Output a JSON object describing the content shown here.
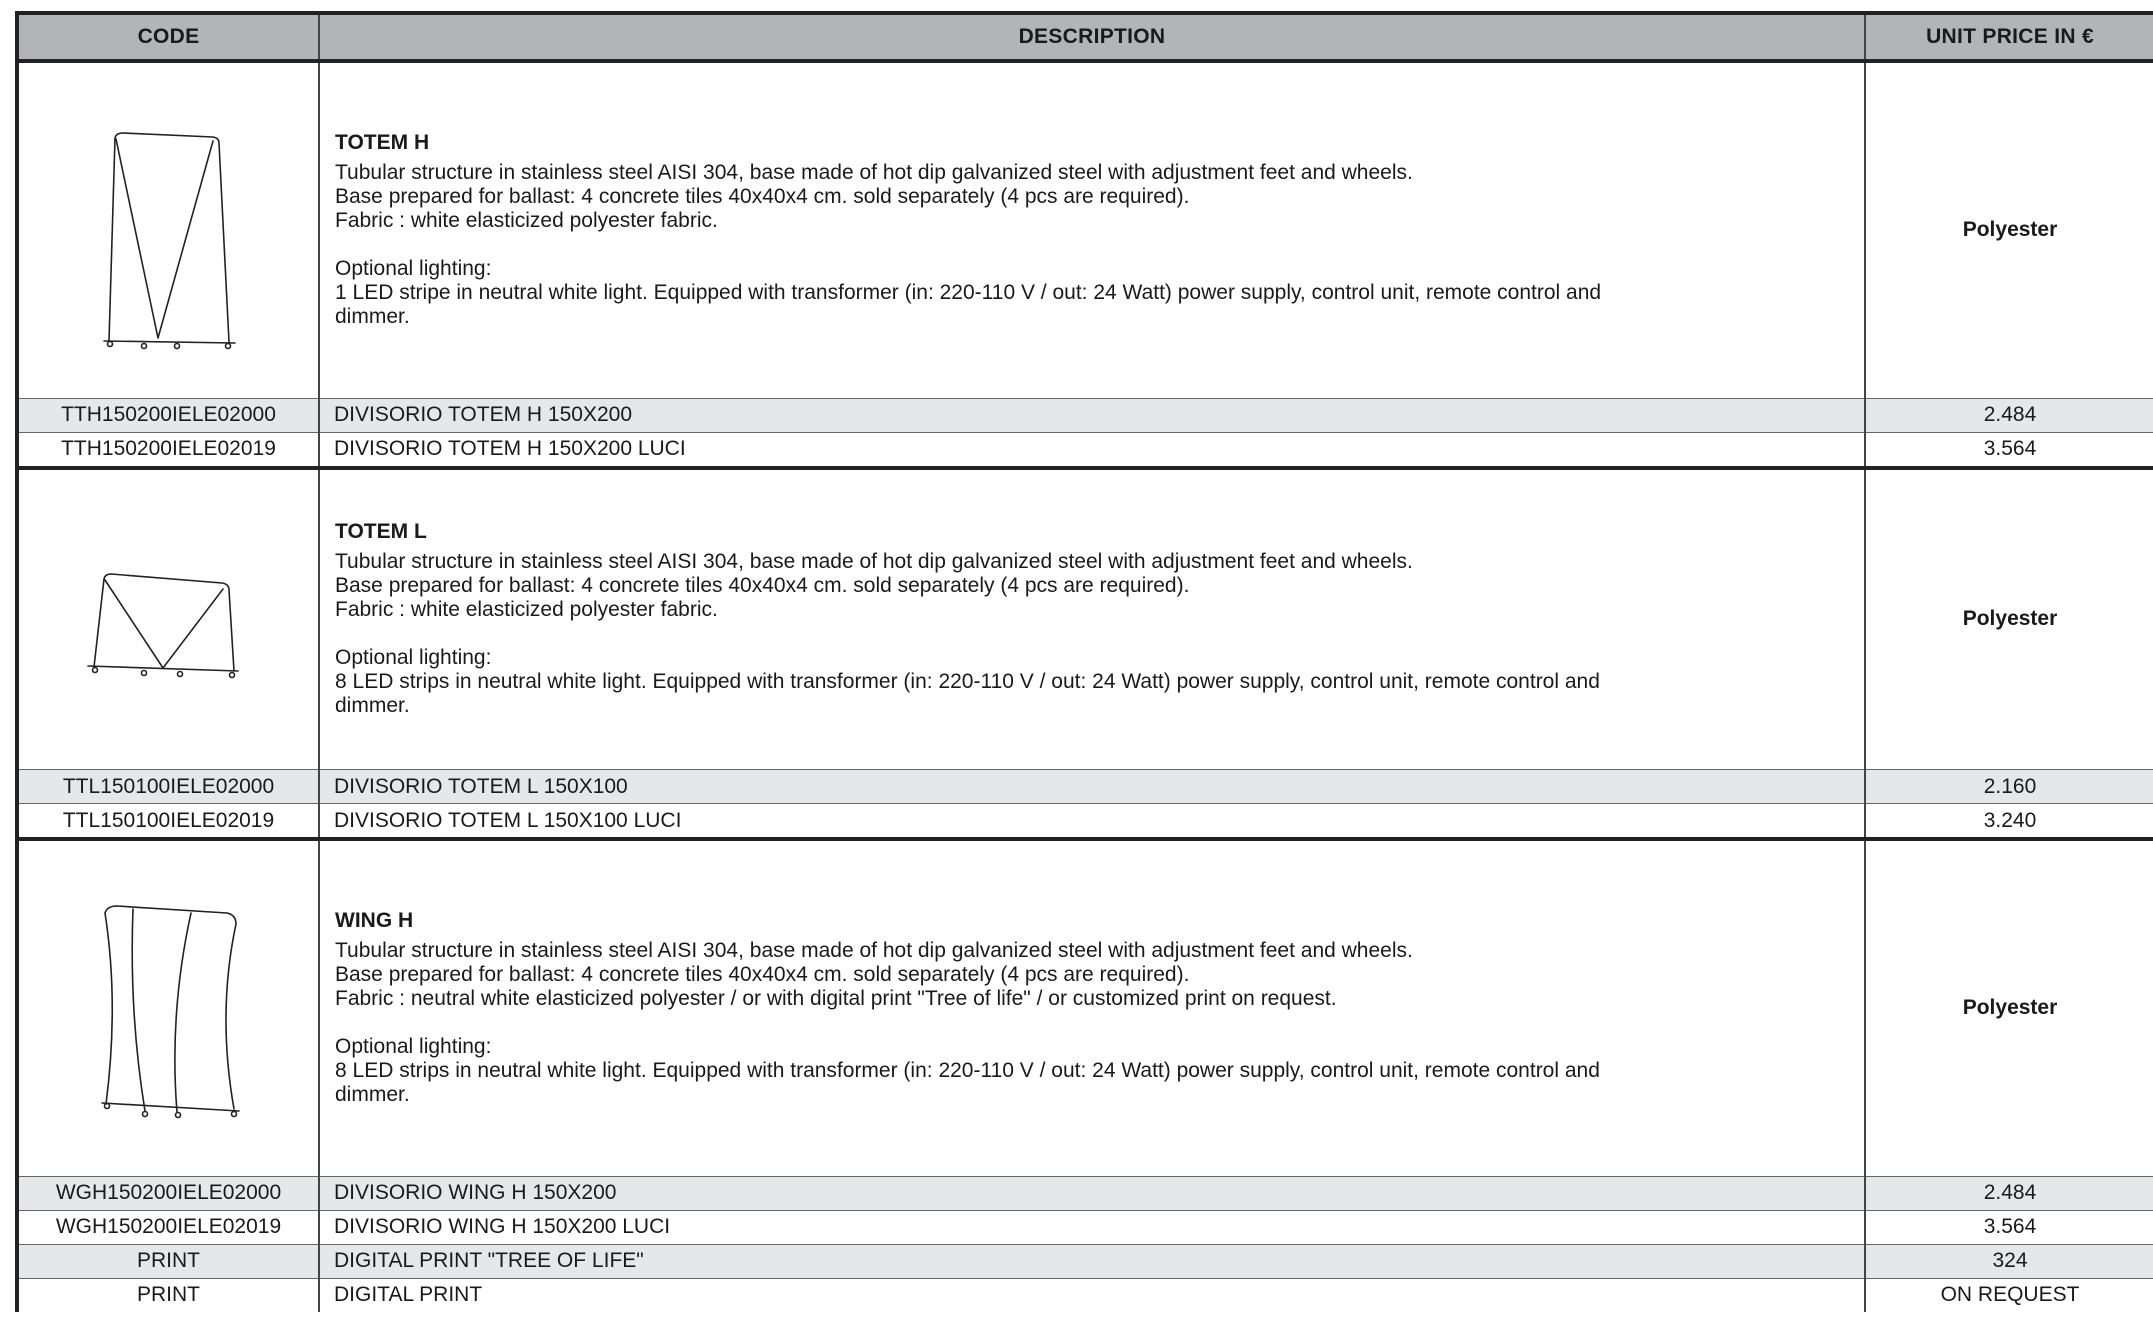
{
  "table": {
    "headers": {
      "code": "CODE",
      "description": "DESCRIPTION",
      "price": "UNIT PRICE IN €"
    }
  },
  "products": [
    {
      "title": "TOTEM H",
      "text_lines": [
        "Tubular structure in stainless steel AISI 304, base made of hot dip galvanized steel with adjustment feet and wheels.",
        "Base prepared for ballast: 4 concrete tiles 40x40x4 cm. sold separately (4 pcs are required).",
        "Fabric : white elasticized polyester fabric."
      ],
      "lighting_heading": "Optional lighting:",
      "lighting_lines": [
        "1 LED stripe in neutral white light. Equipped with transformer (in: 220-110 V / out: 24 Watt) power supply, control unit, remote control and",
        "dimmer."
      ],
      "material": "Polyester",
      "variants": [
        {
          "code": "TTH150200IELE02000",
          "description": "DIVISORIO TOTEM H 150X200",
          "price": "2.484"
        },
        {
          "code": "TTH150200IELE02019",
          "description": "DIVISORIO TOTEM H 150X200 LUCI",
          "price": "3.564"
        }
      ]
    },
    {
      "title": "TOTEM L",
      "text_lines": [
        "Tubular structure in stainless steel AISI 304, base made of hot dip galvanized steel with adjustment feet and wheels.",
        "Base prepared for ballast: 4 concrete tiles 40x40x4 cm. sold separately (4 pcs are required).",
        "Fabric : white elasticized polyester fabric."
      ],
      "lighting_heading": "Optional lighting:",
      "lighting_lines": [
        "8 LED strips in neutral white light. Equipped with transformer (in: 220-110 V / out: 24 Watt) power supply, control unit, remote control and",
        "dimmer."
      ],
      "material": "Polyester",
      "variants": [
        {
          "code": "TTL150100IELE02000",
          "description": "DIVISORIO TOTEM L 150X100",
          "price": "2.160"
        },
        {
          "code": "TTL150100IELE02019",
          "description": "DIVISORIO TOTEM L 150X100 LUCI",
          "price": "3.240"
        }
      ]
    },
    {
      "title": "WING H",
      "text_lines": [
        "Tubular structure in stainless steel AISI 304, base made of hot dip galvanized steel with adjustment feet and wheels.",
        "Base prepared for ballast: 4 concrete tiles 40x40x4 cm. sold separately (4 pcs are required).",
        "Fabric : neutral white elasticized polyester / or with digital print \"Tree of life\" / or customized print on request."
      ],
      "lighting_heading": "Optional lighting:",
      "lighting_lines": [
        "8 LED strips in neutral white light. Equipped with transformer (in: 220-110 V / out: 24 Watt) power supply, control unit, remote control and",
        "dimmer."
      ],
      "material": "Polyester",
      "variants": [
        {
          "code": "WGH150200IELE02000",
          "description": "DIVISORIO WING H 150X200",
          "price": "2.484"
        },
        {
          "code": "WGH150200IELE02019",
          "description": "DIVISORIO WING H 150X200 LUCI",
          "price": "3.564"
        },
        {
          "code": "PRINT",
          "description": "DIGITAL PRINT \"TREE OF LIFE\"",
          "price": "324"
        },
        {
          "code": "PRINT",
          "description": "DIGITAL PRINT",
          "price": "ON REQUEST"
        }
      ]
    }
  ]
}
